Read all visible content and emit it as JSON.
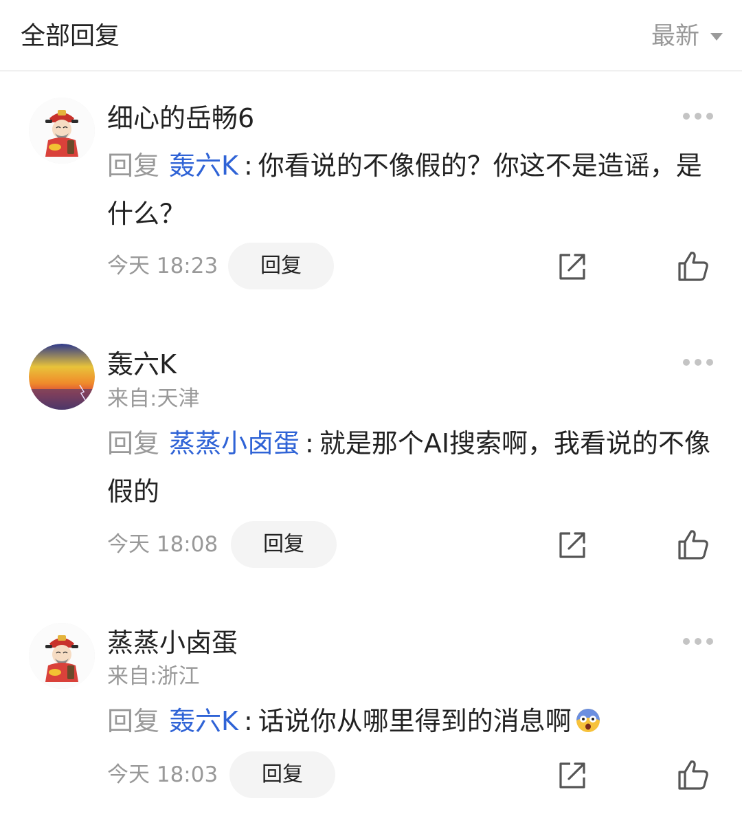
{
  "header": {
    "title": "全部回复",
    "sort_label": "最新",
    "sort_icon": "caret-down-icon"
  },
  "colors": {
    "mention": "#2f63d6",
    "muted": "#999999",
    "text": "#222222",
    "reply_button_bg": "#f4f4f4"
  },
  "comments": [
    {
      "username": "细心的岳畅6",
      "location": "",
      "avatar": "caishen-avatar",
      "reply_prefix": "回复",
      "mention": "轰六K",
      "colon": ":",
      "text": "你看说的不像假的？你这不是造谣，是什么？",
      "time": "今天 18:23",
      "reply_label": "回复"
    },
    {
      "username": "轰六K",
      "location": "来自:天津",
      "avatar": "sunset-avatar",
      "reply_prefix": "回复",
      "mention": "蒸蒸小卤蛋",
      "colon": ":",
      "text": "就是那个AI搜索啊，我看说的不像假的",
      "time": "今天 18:08",
      "reply_label": "回复"
    },
    {
      "username": "蒸蒸小卤蛋",
      "location": "来自:浙江",
      "avatar": "caishen-avatar",
      "reply_prefix": "回复",
      "mention": "轰六K",
      "colon": ":",
      "text": "话说你从哪里得到的消息啊",
      "emoji": "shocked-face-emoji",
      "time": "今天 18:03",
      "reply_label": "回复"
    }
  ]
}
